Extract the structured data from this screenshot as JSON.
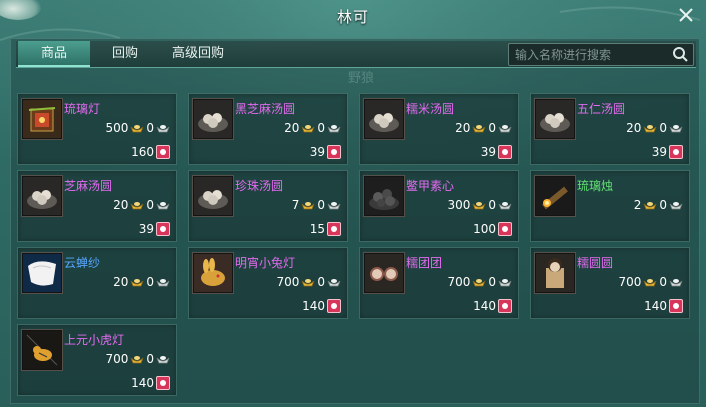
{
  "window": {
    "title": "林可"
  },
  "tabs": [
    {
      "label": "商品",
      "active": true
    },
    {
      "label": "回购",
      "active": false
    },
    {
      "label": "高级回购",
      "active": false
    }
  ],
  "search": {
    "placeholder": "输入名称进行搜索"
  },
  "background_text": [
    "野狼"
  ],
  "colors": {
    "name_purple": "#e36bf0",
    "name_blue": "#57a6ff",
    "name_green": "#64e074",
    "coupon": "#d8355a"
  },
  "items": [
    {
      "name": "琉璃灯",
      "gold": "500",
      "silver": "0",
      "coupon": "160",
      "icon": "lantern-icon",
      "color": "#e36bf0"
    },
    {
      "name": "黑芝麻汤圆",
      "gold": "20",
      "silver": "0",
      "coupon": "39",
      "icon": "tangyuan-icon",
      "color": "#e36bf0"
    },
    {
      "name": "糯米汤圆",
      "gold": "20",
      "silver": "0",
      "coupon": "39",
      "icon": "tangyuan-icon",
      "color": "#e36bf0"
    },
    {
      "name": "五仁汤圆",
      "gold": "20",
      "silver": "0",
      "coupon": "39",
      "icon": "tangyuan-icon",
      "color": "#e36bf0"
    },
    {
      "name": "芝麻汤圆",
      "gold": "20",
      "silver": "0",
      "coupon": "39",
      "icon": "tangyuan-icon",
      "color": "#e36bf0"
    },
    {
      "name": "珍珠汤圆",
      "gold": "7",
      "silver": "0",
      "coupon": "15",
      "icon": "tangyuan-icon",
      "color": "#e36bf0"
    },
    {
      "name": "鳖甲素心",
      "gold": "300",
      "silver": "0",
      "coupon": "100",
      "icon": "dark-dumpling-icon",
      "color": "#e36bf0"
    },
    {
      "name": "琉璃烛",
      "gold": "2",
      "silver": "0",
      "coupon": "",
      "icon": "candle-icon",
      "color": "#64e074"
    },
    {
      "name": "云蝉纱",
      "gold": "20",
      "silver": "0",
      "coupon": "",
      "icon": "silk-icon",
      "color": "#57a6ff"
    },
    {
      "name": "明宵小兔灯",
      "gold": "700",
      "silver": "0",
      "coupon": "140",
      "icon": "rabbit-lantern-icon",
      "color": "#e36bf0"
    },
    {
      "name": "糯团团",
      "gold": "700",
      "silver": "0",
      "coupon": "140",
      "icon": "tuantuan-icon",
      "color": "#e36bf0"
    },
    {
      "name": "糯圆圆",
      "gold": "700",
      "silver": "0",
      "coupon": "140",
      "icon": "yuanyuan-icon",
      "color": "#e36bf0"
    },
    {
      "name": "上元小虎灯",
      "gold": "700",
      "silver": "0",
      "coupon": "140",
      "icon": "tiger-lantern-icon",
      "color": "#e36bf0"
    }
  ]
}
